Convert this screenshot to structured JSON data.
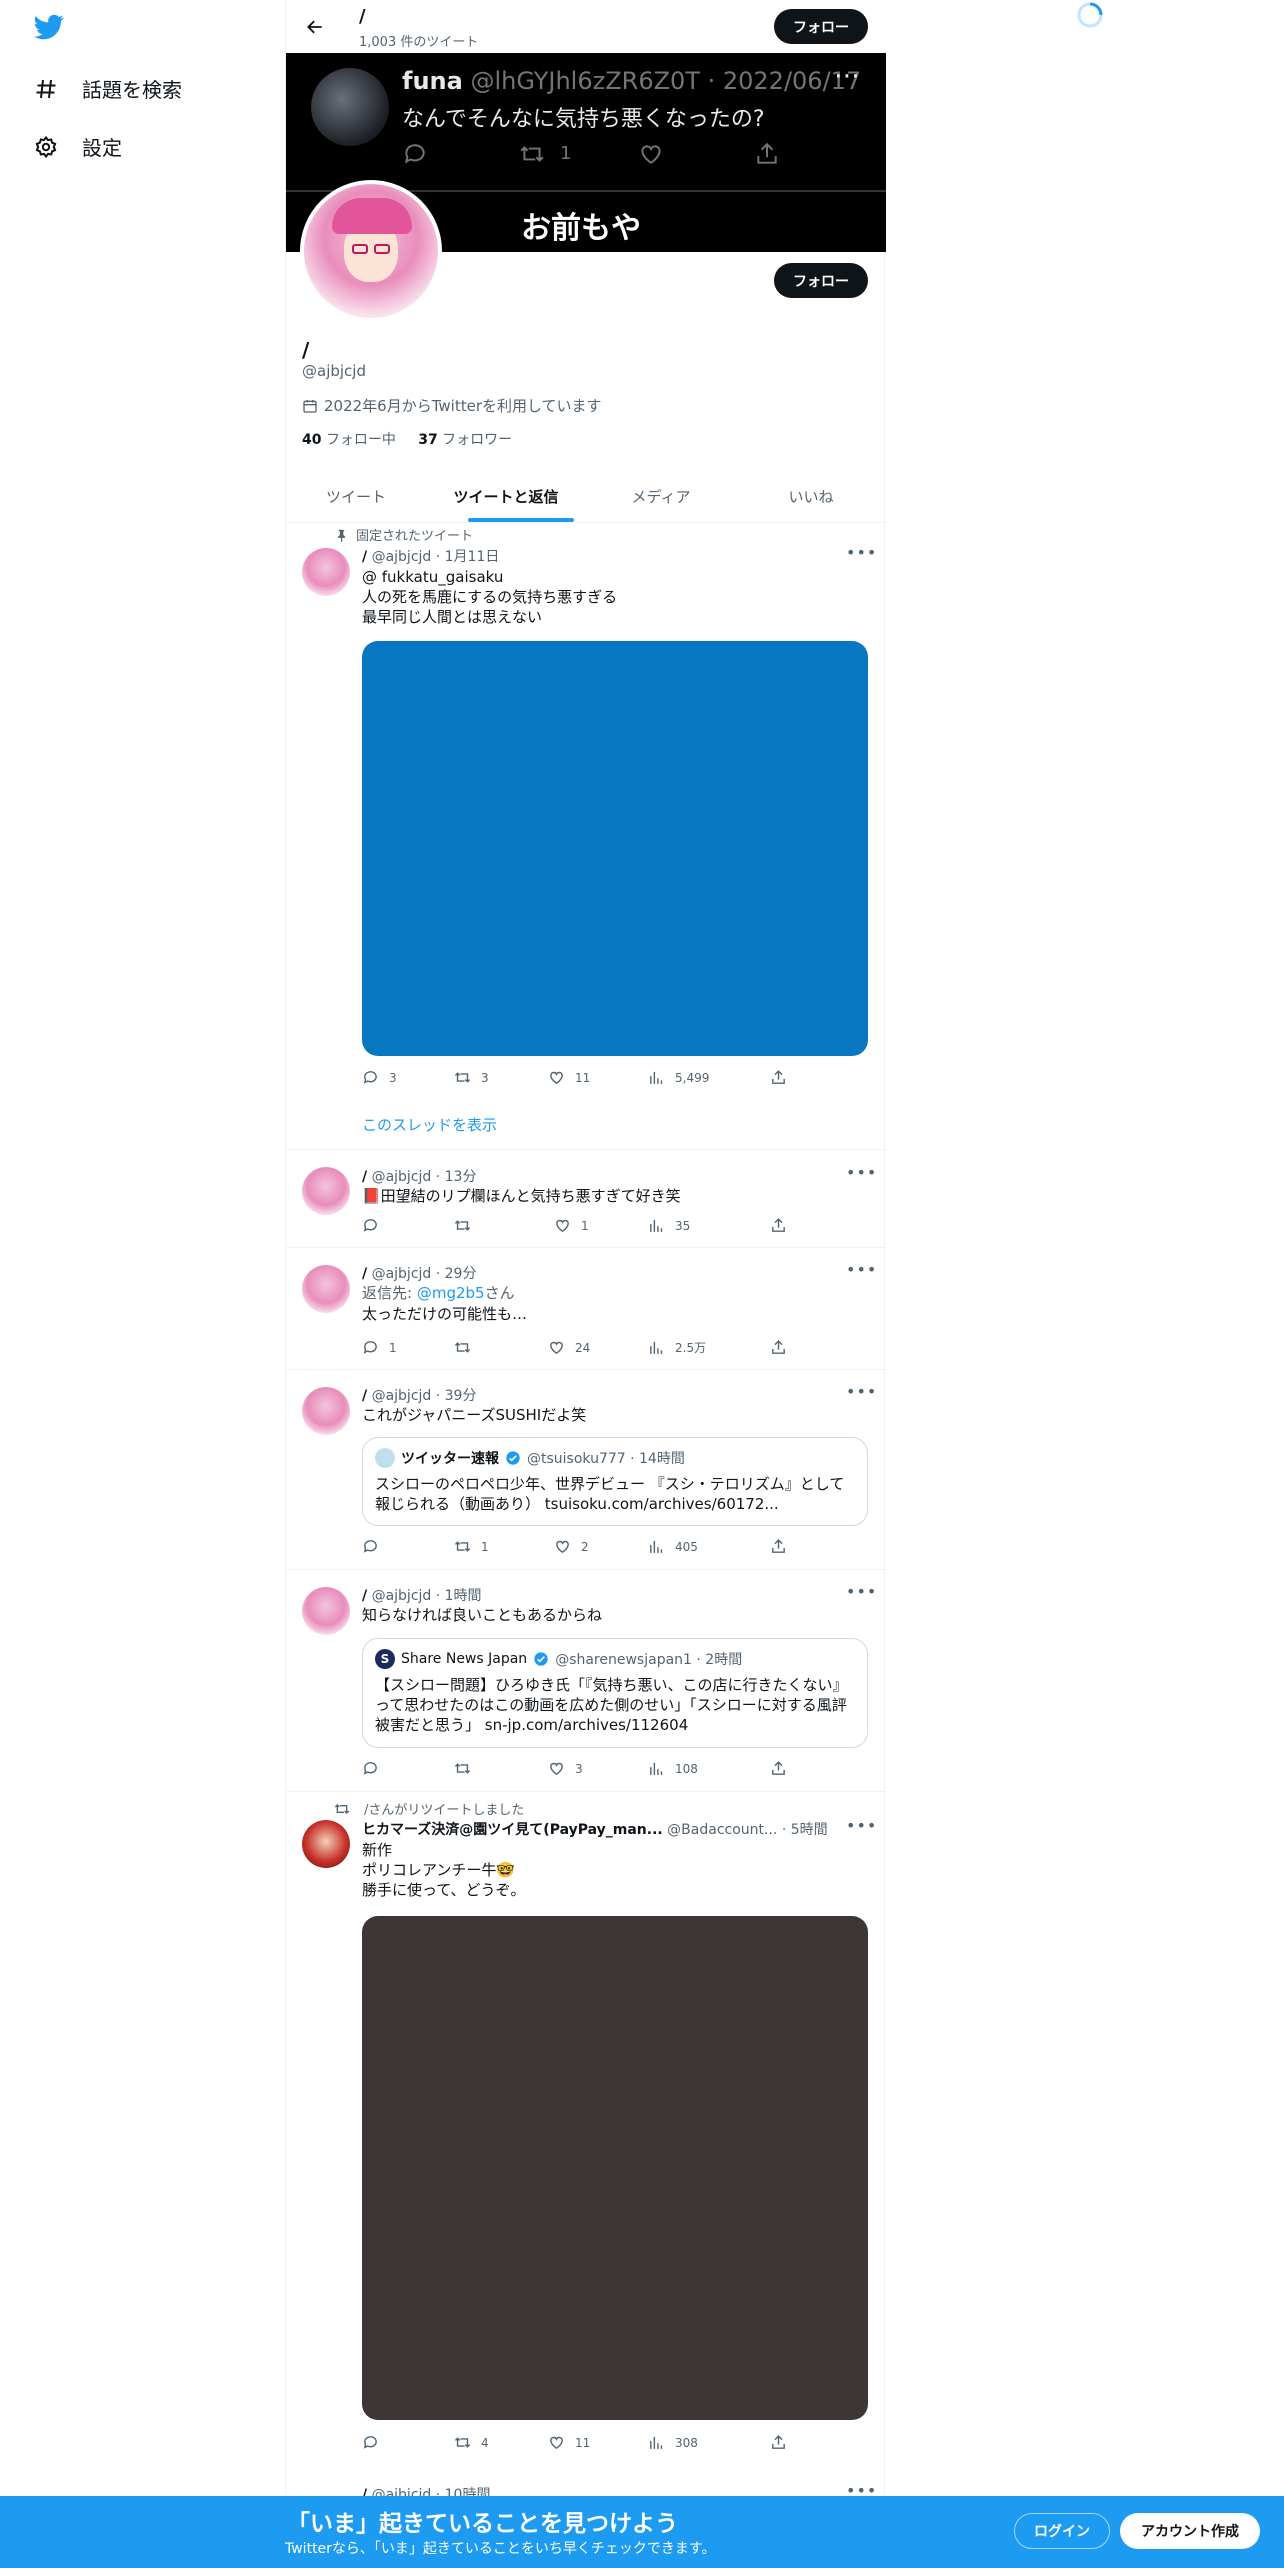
{
  "sidebar": {
    "items": [
      {
        "label": "話題を検索",
        "icon": "hashtag-icon"
      },
      {
        "label": "設定",
        "icon": "gear-icon"
      }
    ]
  },
  "header": {
    "name": "/",
    "tweet_count": "1,003 件のツイート",
    "follow_label": "フォロー"
  },
  "banner": {
    "name": "funa",
    "handle": "@lhGYJhl6zZR6Z0T · 2022/06/17",
    "text": "なんでそんなに気持ち悪くなったの?",
    "retweets": "1",
    "big_text": "お前もや"
  },
  "profile": {
    "follow_label": "フォロー",
    "name": "/",
    "handle": "@ajbjcjd",
    "joined": "2022年6月からTwitterを利用しています",
    "following_count": "40",
    "following_label": "フォロー中",
    "followers_count": "37",
    "followers_label": "フォロワー"
  },
  "tabs": [
    "ツイート",
    "ツイートと返信",
    "メディア",
    "いいね"
  ],
  "tweets": [
    {
      "pinned_label": "固定されたツイート",
      "name": "/",
      "meta": "@ajbjcjd · 1月11日",
      "line1": "@ fukkatu_gaisaku",
      "line2": "人の死を馬鹿にするの気持ち悪すぎる",
      "line3": "最早同じ人間とは思えない",
      "media_color": "#0677c0",
      "replies": "3",
      "retweets": "3",
      "likes": "11",
      "views": "5,499",
      "show_thread": "このスレッドを表示"
    },
    {
      "name": "/",
      "meta": "@ajbjcjd · 13分",
      "line1": "📕田望結のリプ欄ほんと気持ち悪すぎて好き笑",
      "replies": "",
      "retweets": "",
      "likes": "1",
      "views": "35"
    },
    {
      "name": "/",
      "meta": "@ajbjcjd · 29分",
      "reply_prefix": "返信先: ",
      "reply_to": "@mg2b5",
      "reply_suffix": "さん",
      "line1": "太っただけの可能性も…",
      "replies": "1",
      "retweets": "",
      "likes": "24",
      "views": "2.5万"
    },
    {
      "name": "/",
      "meta": "@ajbjcjd · 39分",
      "line1": "これがジャパニーズSUSHIだよ笑",
      "quote_name": "ツイッター速報",
      "quote_meta": "@tsuisoku777 · 14時間",
      "quote_line1": "スシローのペロペロ少年、世界デビュー 『スシ・テロリズム』として",
      "quote_line2": "報じられる（動画あり） tsuisoku.com/archives/60172...",
      "replies": "",
      "retweets": "1",
      "likes": "2",
      "views": "405"
    },
    {
      "name": "/",
      "meta": "@ajbjcjd · 1時間",
      "line1": "知らなければ良いこともあるからね",
      "quote_name": "Share News Japan",
      "quote_meta": "@sharenewsjapan1 · 2時間",
      "quote_line1": "【スシロー問題】ひろゆき氏「『気持ち悪い、この店に行きたくない』",
      "quote_line2": "って思わせたのはこの動画を広めた側のせい」「スシローに対する風評",
      "quote_line3": "被害だと思う」 sn-jp.com/archives/112604",
      "replies": "",
      "retweets": "",
      "likes": "3",
      "views": "108"
    },
    {
      "retweet_label": "/さんがリツイートしました",
      "name": "ヒカマーズ決済@園ツイ見て(PayPay_man...",
      "meta": "@Badaccount... · 5時間",
      "line1": "新作",
      "line2": "ポリコレアンチー牛🤓",
      "line3": "勝手に使って、どうぞ。",
      "media_color": "#3e3636",
      "replies": "",
      "retweets": "4",
      "likes": "11",
      "views": "308"
    },
    {
      "name": "/",
      "meta": "@ajbjcjd · 10時間"
    }
  ],
  "bottom": {
    "title": "「いま」起きていることを見つけよう",
    "subtitle": "Twitterなら、「いま」起きていることをいち早くチェックできます。",
    "login": "ログイン",
    "signup": "アカウント作成"
  },
  "colors": {
    "accent": "#1d9bf0",
    "text": "#0f1419",
    "muted": "#536471"
  }
}
